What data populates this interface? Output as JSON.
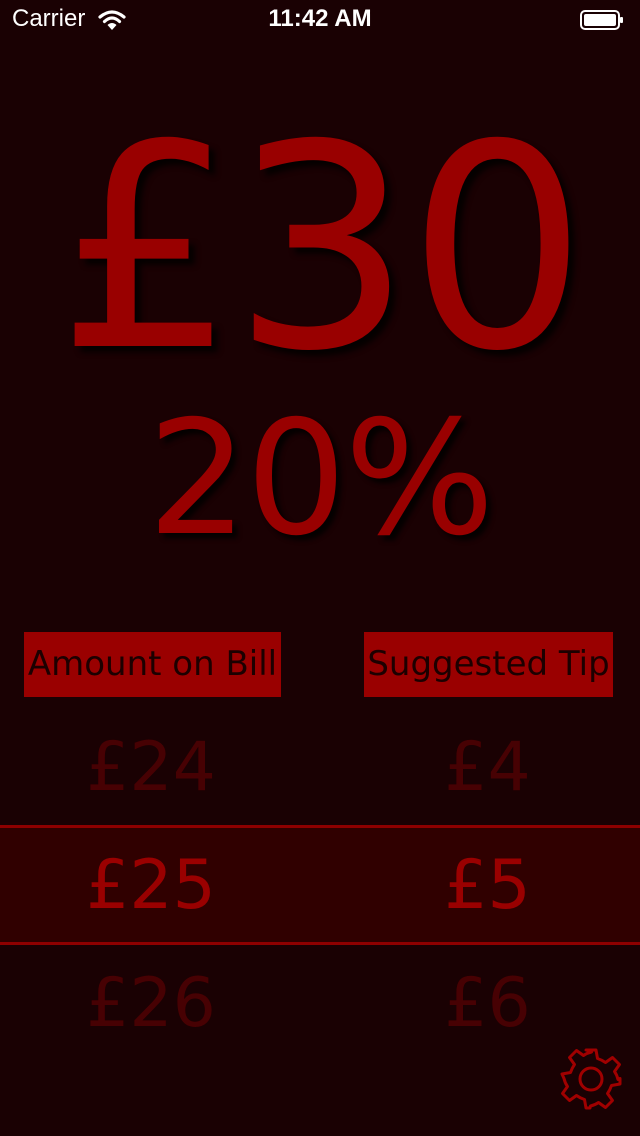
{
  "status_bar": {
    "carrier": "Carrier",
    "time": "11:42 AM"
  },
  "display": {
    "total": "£30",
    "percent": "20%"
  },
  "headers": {
    "amount_on_bill": "Amount on Bill",
    "suggested_tip": "Suggested Tip"
  },
  "picker": {
    "rows": [
      {
        "bill": "£24",
        "tip": "£4",
        "selected": false
      },
      {
        "bill": "£25",
        "tip": "£5",
        "selected": true
      },
      {
        "bill": "£26",
        "tip": "£6",
        "selected": false
      }
    ]
  },
  "icons": {
    "wifi": "wifi-icon",
    "battery": "battery-icon",
    "settings": "gear-icon"
  },
  "colors": {
    "background": "#1a0103",
    "accent": "#990000",
    "faded": "#470103",
    "selection_band": "#300000"
  }
}
